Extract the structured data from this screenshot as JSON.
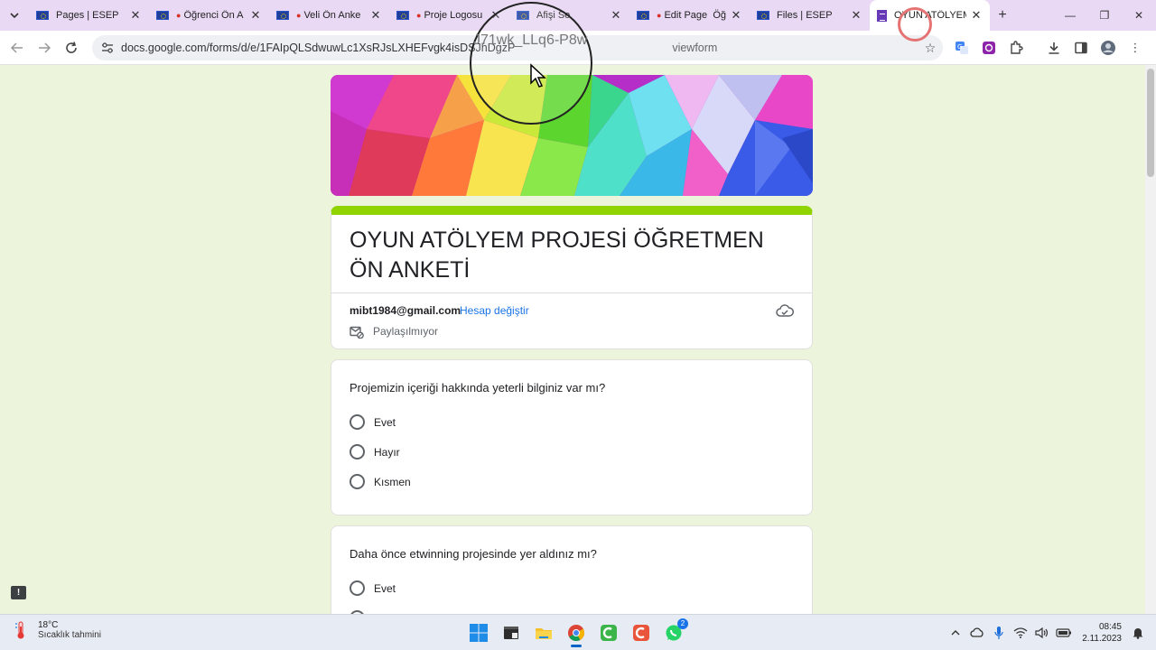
{
  "browser": {
    "tabs": [
      {
        "title": "Pages | ESEP",
        "recording": false,
        "active": false,
        "icon": "eu-flag-icon"
      },
      {
        "title": "Öğrenci Ön A",
        "recording": true,
        "active": false,
        "icon": "eu-flag-icon"
      },
      {
        "title": "Veli Ön Anke",
        "recording": true,
        "active": false,
        "icon": "eu-flag-icon"
      },
      {
        "title": "Proje Logosu",
        "recording": true,
        "active": false,
        "icon": "eu-flag-icon"
      },
      {
        "title": "Afişi Se",
        "recording": false,
        "active": false,
        "icon": "eu-flag-icon"
      },
      {
        "title": "Edit Page",
        "recording": true,
        "active": false,
        "icon": "eu-flag-icon",
        "suffix": "Öğ"
      },
      {
        "title": "Files | ESEP",
        "recording": false,
        "active": false,
        "icon": "eu-flag-icon"
      },
      {
        "title": "OYUN ATÖLYEM",
        "recording": false,
        "active": true,
        "icon": "google-forms-icon"
      }
    ],
    "url": "docs.google.com/forms/d/e/1FAIpQLSdwuwLc1XsRJsLXHEFvgk4isDSJhDgzP",
    "url_tail": "viewform"
  },
  "magnifier_text": "J71wk_LLq6-P8w",
  "form": {
    "title": "OYUN ATÖLYEM PROJESİ ÖĞRETMEN ÖN ANKETİ",
    "accent_color": "#8fd400",
    "email": "mibt1984@gmail.com",
    "switch_account": "Hesap değiştir",
    "sharing": "Paylaşılmıyor",
    "questions": [
      {
        "text": "Projemizin içeriği hakkında yeterli bilginiz var mı?",
        "options": [
          "Evet",
          "Hayır",
          "Kısmen"
        ]
      },
      {
        "text": "Daha önce etwinning projesinde yer aldınız mı?",
        "options": [
          "Evet"
        ]
      }
    ]
  },
  "taskbar": {
    "temperature": "18°C",
    "weather_desc": "Sıcaklık tahmini",
    "whatsapp_badge": "2",
    "time": "08:45",
    "date": "2.11.2023"
  }
}
